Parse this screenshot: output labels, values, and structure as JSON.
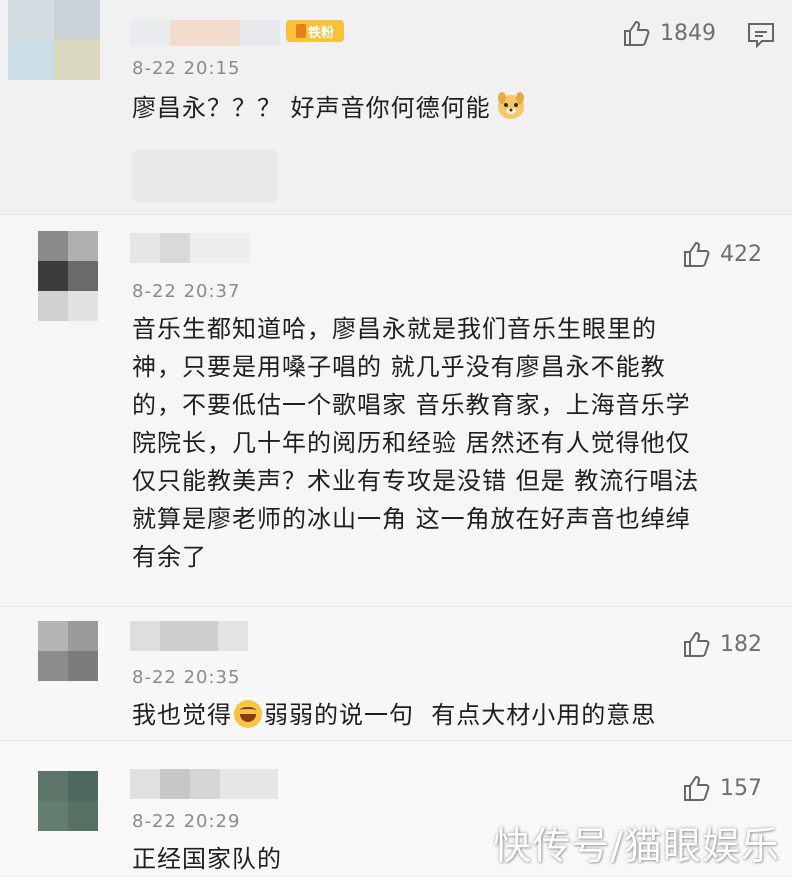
{
  "comments": [
    {
      "time": "8-22 20:15",
      "text": "廖昌永？？？ 好声音你何德何能",
      "likes": "1849",
      "badge": "铁粉"
    },
    {
      "time": "8-22 20:37",
      "lines": [
        "音乐生都知道哈，廖昌永就是我们音乐生眼里的",
        "神，只要是用嗓子唱的 就几乎没有廖昌永不能教",
        "的，不要低估一个歌唱家 音乐教育家，上海音乐学",
        "院院长，几十年的阅历和经验 居然还有人觉得他仅",
        "仅只能教美声？术业有专攻是没错 但是 教流行唱法",
        "就算是廖老师的冰山一角 这一角放在好声音也绰绰",
        "有余了"
      ],
      "likes": "422"
    },
    {
      "time": "8-22 20:35",
      "text_before": "我也觉得",
      "text_after": "弱弱的说一句  有点大材小用的意思",
      "likes": "182"
    },
    {
      "time": "8-22 20:29",
      "text": "正经国家队的",
      "likes": "157"
    }
  ],
  "watermark": "快传号/猫眼娱乐",
  "icons": {
    "like": "thumbs-up-icon",
    "reply": "comment-icon",
    "emoji_dog": "dog-emoji-icon",
    "emoji_laugh": "laughing-emoji-icon"
  },
  "colors": {
    "text": "#1f1f1f",
    "meta": "#8a8a8a",
    "badge": "#f7c23a"
  }
}
